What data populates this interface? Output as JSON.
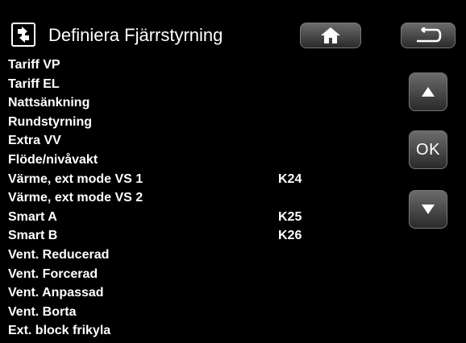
{
  "header": {
    "title": "Definiera Fjärrstyrning",
    "title_icon": "remote-control-icon",
    "home_icon": "home-icon",
    "back_icon": "back-arrow-icon"
  },
  "nav": {
    "up_icon": "arrow-up-icon",
    "ok_label": "OK",
    "down_icon": "arrow-down-icon"
  },
  "rows": [
    {
      "label": "Tariff VP",
      "output": ""
    },
    {
      "label": "Tariff EL",
      "output": ""
    },
    {
      "label": "Nattsänkning",
      "output": ""
    },
    {
      "label": "Rundstyrning",
      "output": ""
    },
    {
      "label": "Extra VV",
      "output": ""
    },
    {
      "label": "Flöde/nivåvakt",
      "output": ""
    },
    {
      "label": "Värme, ext mode VS 1",
      "output": "K24"
    },
    {
      "label": "Värme, ext mode VS 2",
      "output": ""
    },
    {
      "label": "Smart A",
      "output": "K25"
    },
    {
      "label": "Smart B",
      "output": "K26"
    },
    {
      "label": "Vent. Reducerad",
      "output": ""
    },
    {
      "label": "Vent. Forcerad",
      "output": ""
    },
    {
      "label": "Vent. Anpassad",
      "output": ""
    },
    {
      "label": "Vent. Borta",
      "output": ""
    },
    {
      "label": "Ext. block frikyla",
      "output": ""
    }
  ]
}
